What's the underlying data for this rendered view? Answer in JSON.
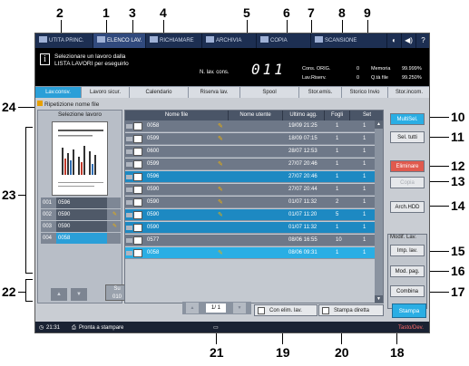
{
  "callouts": {
    "top": [
      "2",
      "1",
      "3",
      "4",
      "5",
      "6",
      "7",
      "8",
      "9"
    ],
    "right": [
      "10",
      "11",
      "12",
      "13",
      "14",
      "15",
      "16",
      "17"
    ],
    "left": [
      "24",
      "23",
      "22"
    ],
    "bottom": [
      "21",
      "19",
      "20",
      "18"
    ]
  },
  "top_nav": [
    {
      "label": "UTITA PRINC."
    },
    {
      "label": "ELENCO LAV."
    },
    {
      "label": "RICHIAMARE"
    },
    {
      "label": "ARCHIVIA"
    },
    {
      "label": "COPIA"
    },
    {
      "label": "SCANSIONE"
    }
  ],
  "top_nav_small": [
    "◐",
    "◀)",
    "?"
  ],
  "message": {
    "info_icon": "i",
    "line1": "Selezionare un lavoro dalla",
    "line2": "LISTA LAVORI per eseguirlo",
    "nlav_label": "N. lav. cons.",
    "nlav_value": "011"
  },
  "stats": [
    {
      "label": "Cons. ORIG.",
      "count": "0",
      "name": "Memoria",
      "pct": "99.999%"
    },
    {
      "label": "Lav.Riserv.",
      "count": "0",
      "name": "Q.tà file",
      "pct": "99.250%"
    }
  ],
  "tabs": [
    "Lav.consv.",
    "Lavoro sicur.",
    "Calendario",
    "Riserva lav.",
    "Spool",
    "Stor.emis.",
    "Storico Invio",
    "Stor.incom."
  ],
  "repeat_label": "Ripetizione nome file",
  "left_panel": {
    "title": "Selezione lavoro",
    "items": [
      {
        "n": "001",
        "job": "0596",
        "pen": ""
      },
      {
        "n": "002",
        "job": "0590",
        "pen": "✎"
      },
      {
        "n": "003",
        "job": "0590",
        "pen": "✎"
      },
      {
        "n": "004",
        "job": "0058",
        "pen": ""
      }
    ],
    "up": "▲",
    "down": "▼",
    "su_label": "Su",
    "su_value": "010"
  },
  "table": {
    "headers": [
      "Nome file",
      "Nome utente",
      "Ultimo agg.",
      "Fogli",
      "Set"
    ],
    "rows": [
      {
        "name": "0058",
        "date": "19/09 21:25",
        "fogli": "1",
        "set": "1",
        "pen": true,
        "state": ""
      },
      {
        "name": "0599",
        "date": "18/09 07:15",
        "fogli": "1",
        "set": "1",
        "pen": true,
        "state": ""
      },
      {
        "name": "0600",
        "date": "28/07 12:53",
        "fogli": "1",
        "set": "1",
        "pen": false,
        "state": ""
      },
      {
        "name": "0599",
        "date": "27/07 20:46",
        "fogli": "1",
        "set": "1",
        "pen": true,
        "state": ""
      },
      {
        "name": "0596",
        "date": "27/07 20:46",
        "fogli": "1",
        "set": "1",
        "pen": false,
        "state": "sel"
      },
      {
        "name": "0590",
        "date": "27/07 20:44",
        "fogli": "1",
        "set": "1",
        "pen": true,
        "state": ""
      },
      {
        "name": "0590",
        "date": "01/07 11:32",
        "fogli": "2",
        "set": "1",
        "pen": true,
        "state": ""
      },
      {
        "name": "0590",
        "date": "01/07 11:20",
        "fogli": "5",
        "set": "1",
        "pen": true,
        "state": "sel"
      },
      {
        "name": "0590",
        "date": "01/07 11:32",
        "fogli": "1",
        "set": "1",
        "pen": false,
        "state": "sel"
      },
      {
        "name": "0577",
        "date": "08/06 16:55",
        "fogli": "10",
        "set": "1",
        "pen": false,
        "state": ""
      },
      {
        "name": "0058",
        "date": "08/06 09:31",
        "fogli": "1",
        "set": "1",
        "pen": true,
        "state": "sel2"
      }
    ]
  },
  "right_buttons": {
    "multisel": "MultiSel.",
    "seltutti": "Sel. tutti",
    "eliminare": "Eliminare",
    "copia": "Copia",
    "archhdd": "Arch.HDD",
    "modif_label": "Modif. Lav.",
    "implav": "Imp. lav.",
    "modpag": "Mod. pag.",
    "combina": "Combina"
  },
  "bottom": {
    "page_value": "1/ 1",
    "prev": "▲",
    "next": "▼",
    "con_elim": "Con elim. lav.",
    "stampa_diretta": "Stampa diretta",
    "stampa": "Stampa"
  },
  "status": {
    "time": "21:31",
    "text": "Pronta a stampare",
    "tasto": "Tasto/Dev."
  },
  "colors": {
    "accent": "#2aaee4",
    "selected_row": "#1d89c2",
    "danger": "#e05a4e",
    "nav_bg": "#1d2f52"
  }
}
